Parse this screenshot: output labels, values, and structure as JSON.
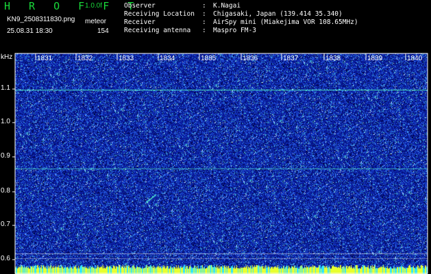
{
  "header": {
    "logo": "H R O F F T",
    "version": "1.0.0f",
    "filename": "KN9_2508311830.png",
    "mode": "meteor",
    "datetime": "25.08.31 18:30",
    "count": "154",
    "info": [
      {
        "key": "Observer",
        "value": "K.Nagai"
      },
      {
        "key": "Receiving Location",
        "value": "Chigasaki, Japan (139.414 35.340)"
      },
      {
        "key": "Receiver",
        "value": "AirSpy mini (Miakejima VOR 108.65MHz)"
      },
      {
        "key": "Receiving antenna",
        "value": "Maspro FM-3"
      }
    ]
  },
  "chart_data": {
    "type": "heatmap",
    "ylabel": "kHz",
    "y_ticks": [
      "1.1",
      "1.0",
      "0.9",
      "0.8",
      "0.7",
      "0.6"
    ],
    "x_ticks": [
      "1831",
      "1832",
      "1833",
      "1834",
      "1835",
      "1836",
      "1837",
      "1838",
      "1839",
      "1840"
    ],
    "colors": {
      "background": "#0a1a9e",
      "noise": "#4a8cff",
      "signal": "#55ffcc",
      "bottom_bar": "#e8ff30"
    }
  }
}
